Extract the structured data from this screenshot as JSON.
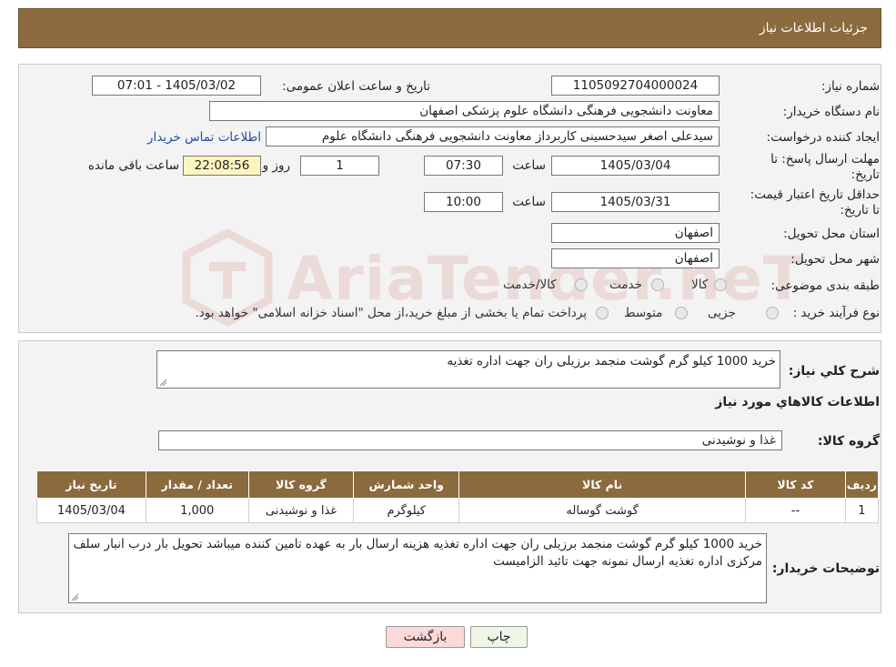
{
  "header": {
    "title": "جزئیات اطلاعات نیاز"
  },
  "form": {
    "need_number": {
      "label": "شماره نیاز:",
      "value": "1105092704000024"
    },
    "announce": {
      "label": "تاریخ و ساعت اعلان عمومی:",
      "value": "1405/03/02 - 07:01"
    },
    "buyer_org": {
      "label": "نام دستگاه خریدار:",
      "value": "معاونت دانشجویی فرهنگی دانشگاه علوم پزشکی اصفهان"
    },
    "requester": {
      "label": "ایجاد کننده درخواست:",
      "value": "سیدعلی اصغر سیدحسینی کاربرداز معاونت دانشجویی فرهنگی دانشگاه علوم",
      "contact_link": "اطلاعات تماس خریدار"
    },
    "deadline": {
      "label": "مهلت ارسال پاسخ: تا تاریخ:",
      "date": "1405/03/04",
      "time_label": "ساعت",
      "time": "07:30",
      "days": "1",
      "days_label": "روز و",
      "remaining": "22:08:56",
      "remaining_label": "ساعت باقی مانده"
    },
    "validity": {
      "label": "حداقل تاریخ اعتبار قیمت: تا تاریخ:",
      "date": "1405/03/31",
      "time_label": "ساعت",
      "time": "10:00"
    },
    "province": {
      "label": "استان محل تحویل:",
      "value": "اصفهان"
    },
    "city": {
      "label": "شهر محل تحویل:",
      "value": "اصفهان"
    },
    "category": {
      "label": "طبقه بندی موضوعی:",
      "options": [
        "کالا",
        "خدمت",
        "کالا/خدمت"
      ]
    },
    "process": {
      "label": "نوع فرآیند خرید :",
      "options": [
        "جزیی",
        "متوسط"
      ],
      "note": "پرداخت تمام یا بخشی از مبلغ خرید،از محل \"اسناد خزانه اسلامی\" خواهد بود."
    }
  },
  "summary": {
    "label": "شرح کلي نياز:",
    "value": "خرید 1000 کیلو گرم گوشت منجمد برزیلی ران  جهت اداره تغذیه",
    "items_title": "اطلاعات كالاهاي مورد نياز",
    "group_label": "گروه کالا:",
    "group_value": "غذا و نوشیدنی"
  },
  "table": {
    "headers": [
      "ردیف",
      "کد کالا",
      "نام کالا",
      "واحد شمارش",
      "گروه کالا",
      "تعداد / مقدار",
      "تاریخ نیاز"
    ],
    "rows": [
      [
        "1",
        "--",
        "گوشت گوساله",
        "کیلوگرم",
        "غذا و نوشیدنی",
        "1,000",
        "1405/03/04"
      ]
    ]
  },
  "buyer_notes": {
    "label": "توضیحات خریدار:",
    "value": "خرید 1000 کیلو گرم گوشت منجمد برزیلی ران  جهت اداره تغذیه هزینه ارسال بار به عهده تامین کننده میباشد تحویل بار درب انبار سلف مرکزی اداره تغذیه ارسال نمونه جهت تائید الزامیست"
  },
  "buttons": {
    "print": "چاپ",
    "back": "بازگشت"
  },
  "watermark": {
    "text": "AriaTender.neT"
  },
  "colors": {
    "header": "#8b6a3e",
    "link": "#1f4ea1",
    "back_button": "#fbd9d9",
    "print_button": "#eef6e8",
    "remaining_bg": "#fdf5c0",
    "watermark": "#c0392b"
  }
}
